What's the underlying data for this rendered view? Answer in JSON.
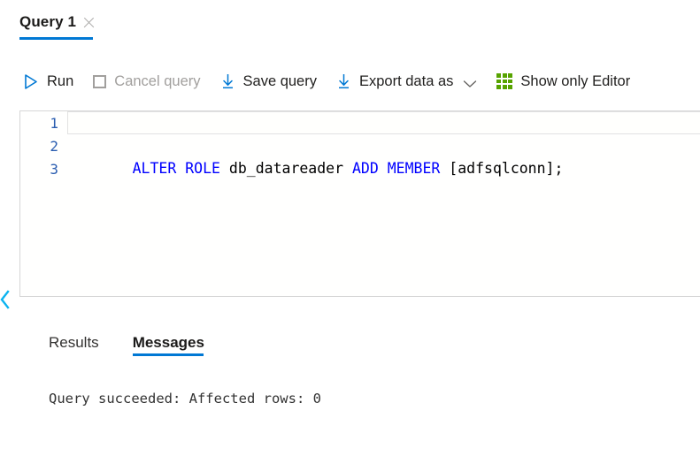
{
  "tab": {
    "label": "Query 1",
    "close_icon": "close-icon",
    "accent_color": "#0078d4"
  },
  "toolbar": {
    "commands": [
      {
        "id": "run",
        "label": "Run",
        "icon": "play-icon",
        "disabled": false,
        "has_chevron": false
      },
      {
        "id": "cancel-query",
        "label": "Cancel query",
        "icon": "stop-icon",
        "disabled": true,
        "has_chevron": false
      },
      {
        "id": "save-query",
        "label": "Save query",
        "icon": "download-icon",
        "disabled": false,
        "has_chevron": false
      },
      {
        "id": "export-data",
        "label": "Export data as",
        "icon": "download-icon",
        "disabled": false,
        "has_chevron": true
      },
      {
        "id": "show-editor",
        "label": "Show only Editor",
        "icon": "grid-icon",
        "disabled": false,
        "has_chevron": false
      }
    ],
    "grid_icon_color": "#57a300",
    "run_icon_color": "#0078d4"
  },
  "editor": {
    "lines": [
      {
        "number": "1",
        "current": true,
        "tokens": []
      },
      {
        "number": "2",
        "current": false,
        "tokens": [
          {
            "t": "ALTER",
            "kw": true
          },
          {
            "t": " ",
            "kw": false
          },
          {
            "t": "ROLE",
            "kw": true
          },
          {
            "t": " db_datareader ",
            "kw": false
          },
          {
            "t": "ADD",
            "kw": true
          },
          {
            "t": " ",
            "kw": false
          },
          {
            "t": "MEMBER",
            "kw": true
          },
          {
            "t": " [adfsqlconn];",
            "kw": false
          }
        ]
      },
      {
        "number": "3",
        "current": false,
        "tokens": []
      }
    ],
    "keyword_color": "#0000ff",
    "line_number_color": "#2a5db0",
    "collapse_icon": "chevron-left-icon"
  },
  "results_pivot": {
    "items": [
      {
        "id": "results",
        "label": "Results",
        "active": false
      },
      {
        "id": "messages",
        "label": "Messages",
        "active": true
      }
    ]
  },
  "messages": {
    "text": "Query succeeded: Affected rows: 0"
  }
}
